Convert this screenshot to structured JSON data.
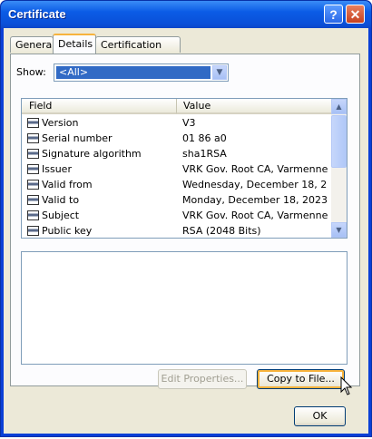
{
  "window": {
    "title": "Certificate",
    "help_glyph": "?",
    "close_glyph": "✕"
  },
  "tabs": [
    {
      "label": "General"
    },
    {
      "label": "Details"
    },
    {
      "label": "Certification Path"
    }
  ],
  "show": {
    "label": "Show:",
    "value": "<All>"
  },
  "list": {
    "headers": {
      "field": "Field",
      "value": "Value"
    },
    "rows": [
      {
        "field": "Version",
        "value": "V3"
      },
      {
        "field": "Serial number",
        "value": "01 86 a0"
      },
      {
        "field": "Signature algorithm",
        "value": "sha1RSA"
      },
      {
        "field": "Issuer",
        "value": "VRK Gov. Root CA, Varmenne..."
      },
      {
        "field": "Valid from",
        "value": "Wednesday, December 18, 20..."
      },
      {
        "field": "Valid to",
        "value": "Monday, December 18, 2023 ..."
      },
      {
        "field": "Subject",
        "value": "VRK Gov. Root CA, Varmenne..."
      },
      {
        "field": "Public key",
        "value": "RSA (2048 Bits)"
      }
    ]
  },
  "buttons": {
    "edit_properties": "Edit Properties...",
    "copy_to_file": "Copy to File...",
    "ok": "OK"
  }
}
